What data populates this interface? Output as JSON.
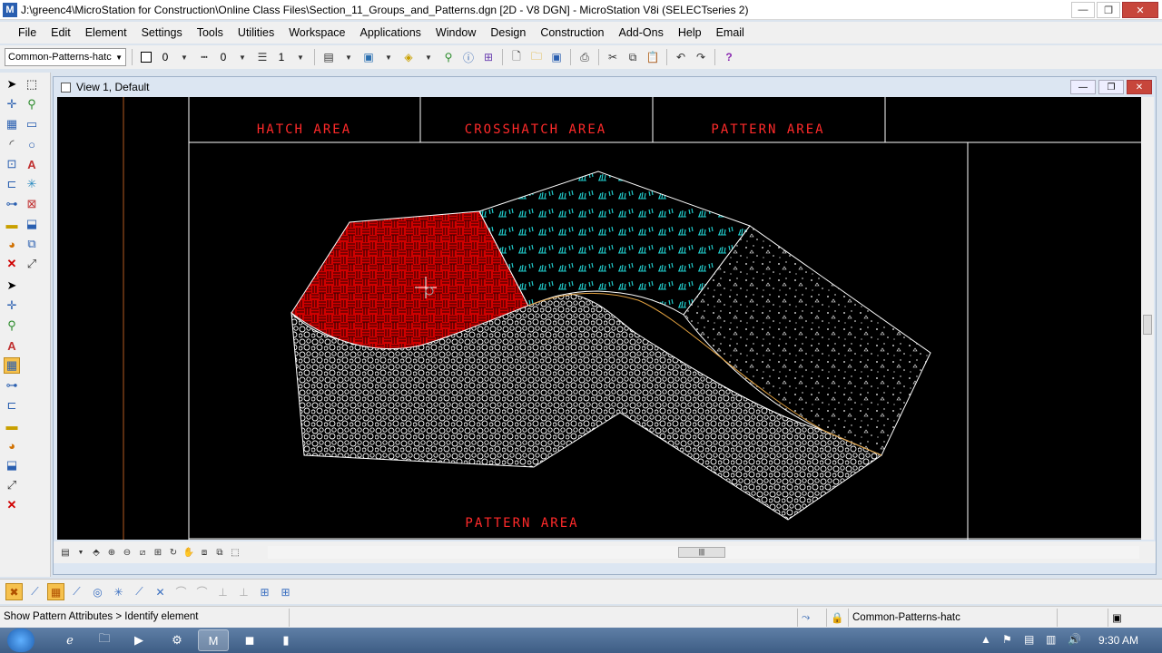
{
  "window": {
    "title": "J:\\greenc4\\MicroStation for Construction\\Online Class Files\\Section_11_Groups_and_Patterns.dgn [2D - V8 DGN] - MicroStation V8i (SELECTseries 2)",
    "minimize": "—",
    "maximize": "❐",
    "close": "✕"
  },
  "menu": [
    "File",
    "Edit",
    "Element",
    "Settings",
    "Tools",
    "Utilities",
    "Workspace",
    "Applications",
    "Window",
    "Design",
    "Construction",
    "Add-Ons",
    "Help",
    "Email"
  ],
  "toolbar": {
    "active_level": "Common-Patterns-hatc",
    "color_value": "0",
    "style_value": "0",
    "weight_value": "1"
  },
  "view": {
    "title": "View 1, Default",
    "labels": {
      "hatch": "HATCH AREA",
      "crosshatch": "CROSSHATCH AREA",
      "pattern_top": "PATTERN AREA",
      "pattern_bottom": "PATTERN AREA"
    },
    "colors": {
      "background": "#000000",
      "hatch_fill": "#d00000",
      "crosshatch": "#20c8c8",
      "pattern": "#ffffff",
      "text": "#ff2a2a"
    }
  },
  "status": {
    "prompt": "Show Pattern Attributes > Identify element",
    "active_level": "Common-Patterns-hatc"
  },
  "taskbar": {
    "clock": "9:30 AM"
  }
}
